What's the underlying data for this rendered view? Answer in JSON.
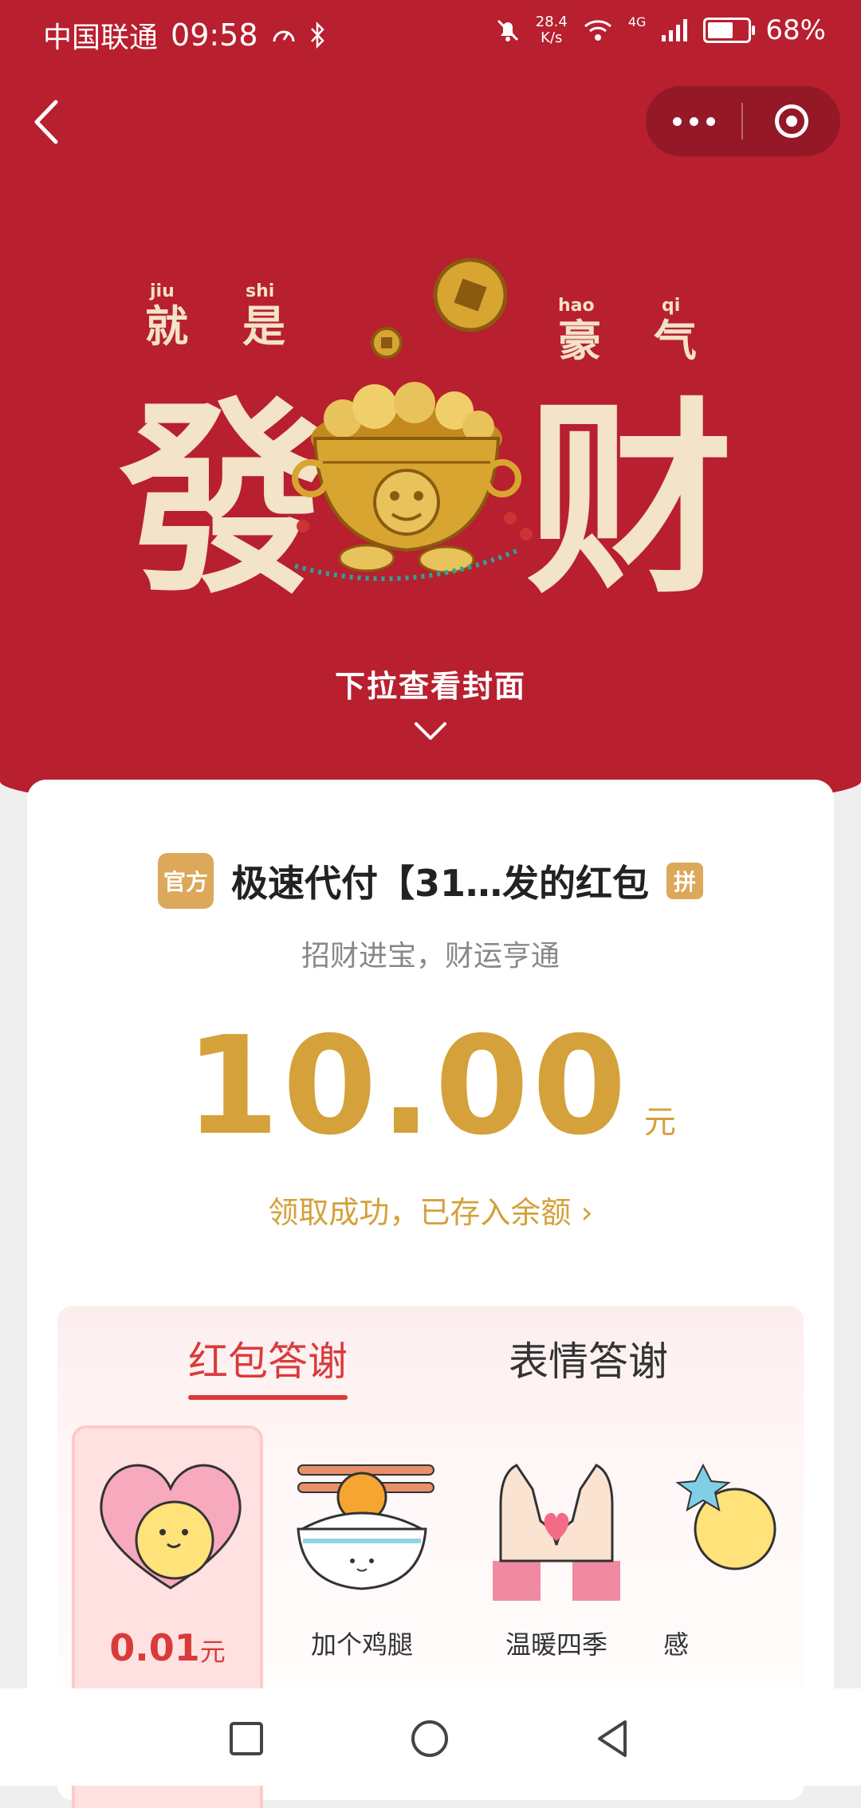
{
  "status_bar": {
    "carrier": "中国联通",
    "time": "09:58",
    "speed_value": "28.4",
    "speed_unit": "K/s",
    "network": "4G",
    "battery": "68%",
    "battery_level": 0.68
  },
  "cover": {
    "small_chars": [
      "就",
      "是",
      "豪",
      "气"
    ],
    "pinyin": [
      "jiu",
      "shi",
      "hao",
      "qi"
    ],
    "big_left": "發",
    "big_right": "财",
    "pull_hint": "下拉查看封面"
  },
  "packet": {
    "official_badge": "官方",
    "sender": "极速代付【31…发的红包",
    "pin_badge": "拼",
    "blessing": "招财进宝，财运亨通",
    "amount": "10.00",
    "unit": "元",
    "status_link": "领取成功，已存入余额 ›"
  },
  "thanks": {
    "tabs": [
      {
        "label": "红包答谢",
        "active": true
      },
      {
        "label": "表情答谢",
        "active": false
      }
    ],
    "gifts": [
      {
        "label": "",
        "price": "0.01",
        "unit": "元",
        "selected": true
      },
      {
        "label": "加个鸡腿",
        "selected": false
      },
      {
        "label": "温暖四季",
        "selected": false
      },
      {
        "label": "感",
        "selected": false
      }
    ]
  },
  "colors": {
    "header_red": "#b81f2f",
    "gold": "#d4a13a",
    "accent_red": "#d93b3b"
  }
}
